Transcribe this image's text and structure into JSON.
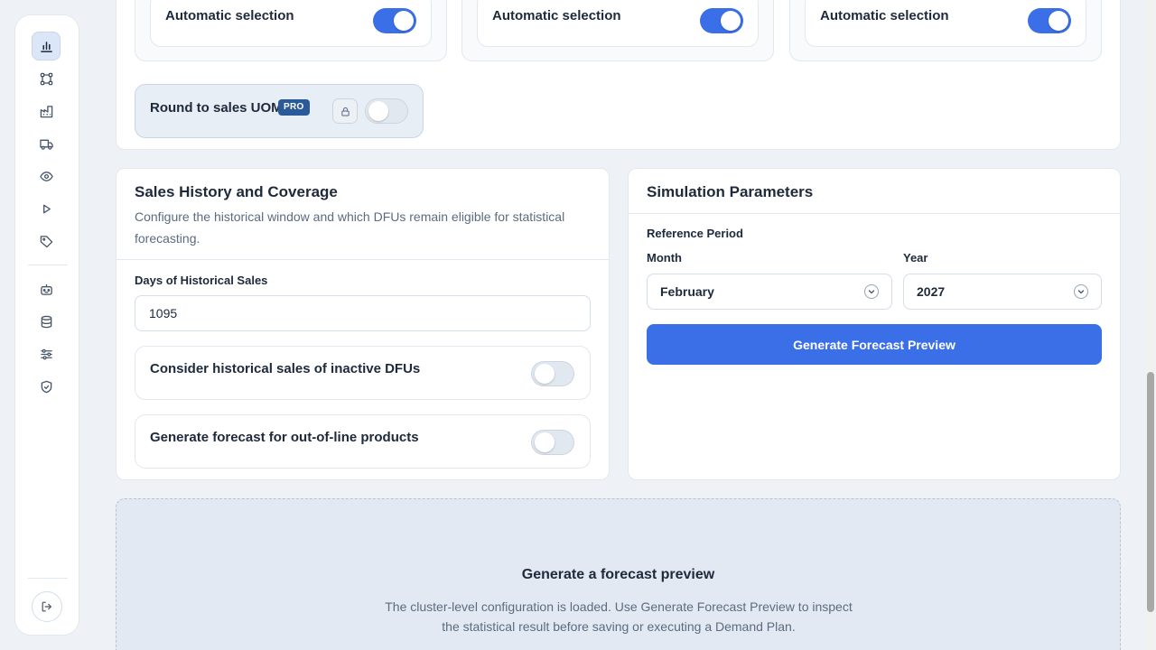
{
  "sidebar": {
    "items": [
      {
        "icon": "bar-chart-icon",
        "active": true
      },
      {
        "icon": "network-icon",
        "active": false
      },
      {
        "icon": "factory-icon",
        "active": false
      },
      {
        "icon": "truck-icon",
        "active": false
      },
      {
        "icon": "eye-icon",
        "active": false
      },
      {
        "icon": "play-icon",
        "active": false
      },
      {
        "icon": "tag-icon",
        "active": false
      },
      {
        "icon": "robot-icon",
        "active": false
      },
      {
        "icon": "database-icon",
        "active": false
      },
      {
        "icon": "sliders-icon",
        "active": false
      },
      {
        "icon": "shield-check-icon",
        "active": false
      }
    ],
    "logout_icon": "logout-icon"
  },
  "auto_selection": [
    {
      "label": "Automatic selection",
      "enabled": true
    },
    {
      "label": "Automatic selection",
      "enabled": true
    },
    {
      "label": "Automatic selection",
      "enabled": true
    }
  ],
  "round_uom": {
    "label": "Round to sales UOM",
    "badge": "PRO",
    "locked": true,
    "enabled": false
  },
  "sales_history": {
    "title": "Sales History and Coverage",
    "description": "Configure the historical window and which DFUs remain eligible for statistical forecasting.",
    "days_label": "Days of Historical Sales",
    "days_value": "1095",
    "options": [
      {
        "label": "Consider historical sales of inactive DFUs",
        "enabled": false
      },
      {
        "label": "Generate forecast for out-of-line products",
        "enabled": false
      }
    ]
  },
  "simulation": {
    "title": "Simulation Parameters",
    "reference_label": "Reference Period",
    "month_label": "Month",
    "month_value": "February",
    "year_label": "Year",
    "year_value": "2027",
    "button_label": "Generate Forecast Preview"
  },
  "preview": {
    "title": "Generate a forecast preview",
    "description": "The cluster-level configuration is loaded. Use Generate Forecast Preview to inspect the statistical result before saving or executing a Demand Plan."
  },
  "colors": {
    "accent": "#3b6fe8",
    "badge": "#2b5a98",
    "background": "#eef2f7"
  }
}
